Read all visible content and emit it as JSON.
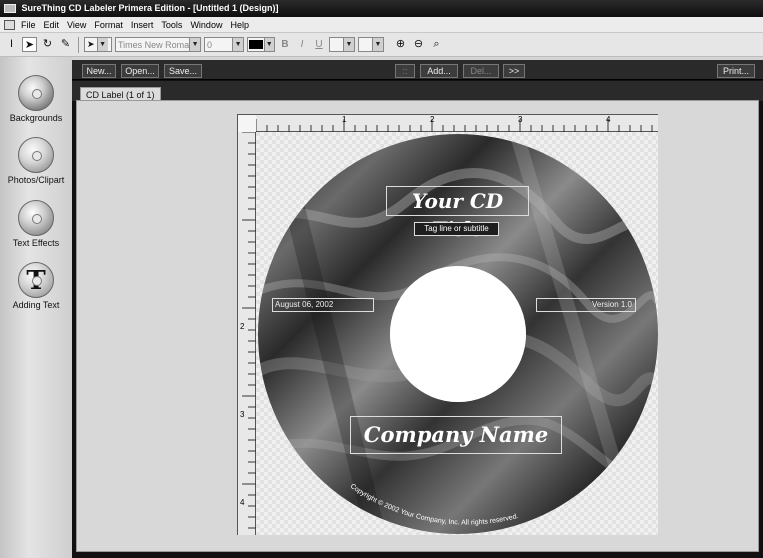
{
  "window": {
    "title": "SureThing CD Labeler Primera Edition - [Untitled 1 (Design)]"
  },
  "menu": [
    "File",
    "Edit",
    "View",
    "Format",
    "Insert",
    "Tools",
    "Window",
    "Help"
  ],
  "toolbar": {
    "font_name": "Times New Roman",
    "font_size": "0",
    "bold": "B",
    "italic": "I",
    "underline": "U"
  },
  "sidebar": {
    "backgrounds": "Backgrounds",
    "photos": "Photos/Clipart",
    "text_effects": "Text Effects",
    "adding_text": "Adding Text",
    "adding_text_glyph": "T"
  },
  "commands": {
    "new": "New...",
    "open": "Open...",
    "save": "Save...",
    "prev": "::",
    "add": "Add...",
    "delete": "Del...",
    "next": ">>",
    "print": "Print..."
  },
  "tab": {
    "label": "CD Label (1 of 1)"
  },
  "ruler": {
    "top": [
      "1",
      "2",
      "3",
      "4"
    ],
    "left": [
      "2",
      "3",
      "4"
    ]
  },
  "label": {
    "title": "Your CD Title",
    "tagline": "Tag line or subtitle",
    "date": "August 06, 2002",
    "version": "Version 1.0",
    "company": "Company Name",
    "copyright": "Copyright © 2002 Your Company, Inc. All rights reserved."
  }
}
